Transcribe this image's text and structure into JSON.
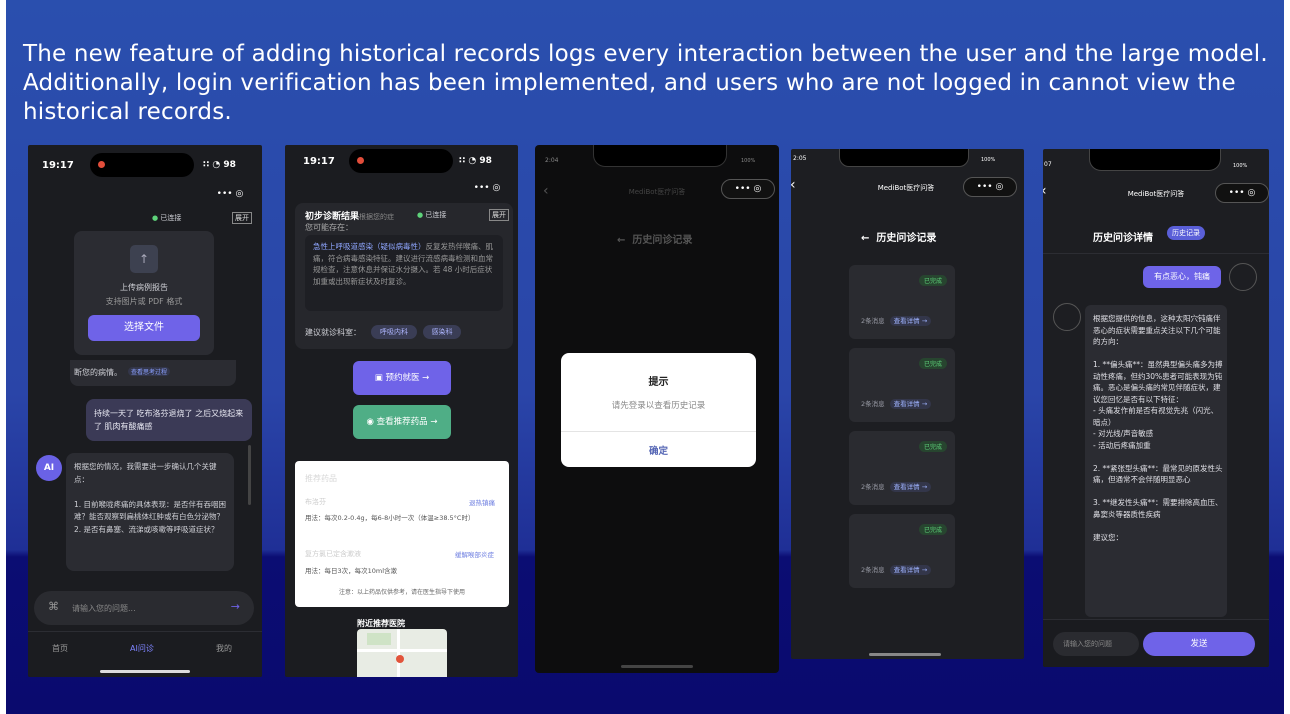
{
  "caption": "The new feature of adding historical records logs every interaction between the user and the large model. Additionally, login verification has been implemented, and users who are not logged in cannot view the historical records.",
  "phone1": {
    "time": "19:17",
    "status_icons": "∷ ◔ 98",
    "connected": "已连接",
    "expand": "展开",
    "upload_title": "上传病例报告",
    "upload_sub": "支持图片或 PDF 格式",
    "select_file": "选择文件",
    "msg_prev": "断您的病情。",
    "msg_prev_link": "查看思考过程",
    "user_msg": "持续一天了 吃布洛芬退烧了 之后又烧起来了 肌肉有酸痛感",
    "ai_avatar": "AI",
    "ai_msg": "根据您的情况，我需要进一步确认几个关键点：\n\n1. 目前喉咙疼痛的具体表现：是否伴有吞咽困难？能否观察到扁桃体红肿或有白色分泌物？\n2. 是否有鼻塞、流涕或咳嗽等呼吸道症状？",
    "input_placeholder": "请输入您的问题...",
    "nav": [
      "首页",
      "AI问诊",
      "我的"
    ]
  },
  "phone2": {
    "time": "19:17",
    "status_icons": "∷ ◔ 98",
    "title": "初步诊断结果",
    "title_tail": "根据您的症",
    "connected": "已连接",
    "expand": "展开",
    "may_exist": "您可能存在：",
    "diagnosis_head": "急性上呼吸道感染（疑似病毒性）",
    "diagnosis_body": "反复发热伴喉痛、肌痛，符合病毒感染特征。建议进行流感病毒检测和血常规检查，注意休息并保证水分摄入。若 48 小时后症状加重或出现新症状及时复诊。",
    "dept_label": "建议就诊科室：",
    "dept_tags": [
      "呼吸内科",
      "感染科"
    ],
    "book_button": "预约就医 →",
    "drug_button": "查看推荐药品 →",
    "drug_card_title": "推荐药品",
    "drug1_name": "布洛芬",
    "drug1_tag": "退热镇痛",
    "drug1_use": "用法：每次0.2-0.4g，每6-8小时一次（体温≥38.5°C时）",
    "drug2_name": "复方氯已定含漱液",
    "drug2_tag": "缓解喉部炎症",
    "drug2_use": "用法：每日3次，每次10ml含漱",
    "note": "注意：以上药品仅供参考，请在医生指导下使用",
    "hospital_title": "附近推荐医院"
  },
  "phone3": {
    "time": "2:04",
    "battery": "100%",
    "app_title": "MediBot医疗问答",
    "page_title": "历史问诊记录",
    "dialog_title": "提示",
    "dialog_message": "请先登录以查看历史记录",
    "dialog_confirm": "确定"
  },
  "phone4": {
    "time": "2:05",
    "battery": "100%",
    "app_title": "MediBot医疗问答",
    "page_title": "历史问诊记录",
    "records": [
      {
        "status": "已完成",
        "count": "2条消息",
        "link": "查看详情 →"
      },
      {
        "status": "已完成",
        "count": "2条消息",
        "link": "查看详情 →"
      },
      {
        "status": "已完成",
        "count": "2条消息",
        "link": "查看详情 →"
      },
      {
        "status": "已完成",
        "count": "2条消息",
        "link": "查看详情 →"
      }
    ]
  },
  "phone5": {
    "time": "07",
    "battery": "100%",
    "app_title": "MediBot医疗问答",
    "page_title": "历史问诊详情",
    "history_tag": "历史记录",
    "user_msg": "有点恶心，钝痛",
    "ai_msg": "根据您提供的信息，这种太阳穴钝痛伴恶心的症状需要重点关注以下几个可能的方向：\n\n1. **偏头痛**：虽然典型偏头痛多为搏动性疼痛，但约30%患者可能表现为钝痛。恶心是偏头痛的常见伴随症状，建议您回忆是否有以下特征：\n- 头痛发作前是否有视觉先兆（闪光、暗点）\n- 对光线/声音敏感\n- 活动后疼痛加重\n\n2. **紧张型头痛**：最常见的原发性头痛，但通常不会伴随明显恶心\n\n3. **继发性头痛**：需要排除高血压、鼻窦炎等器质性疾病\n\n建议您：",
    "input_placeholder": "请输入您的问题",
    "send_button": "发送"
  }
}
